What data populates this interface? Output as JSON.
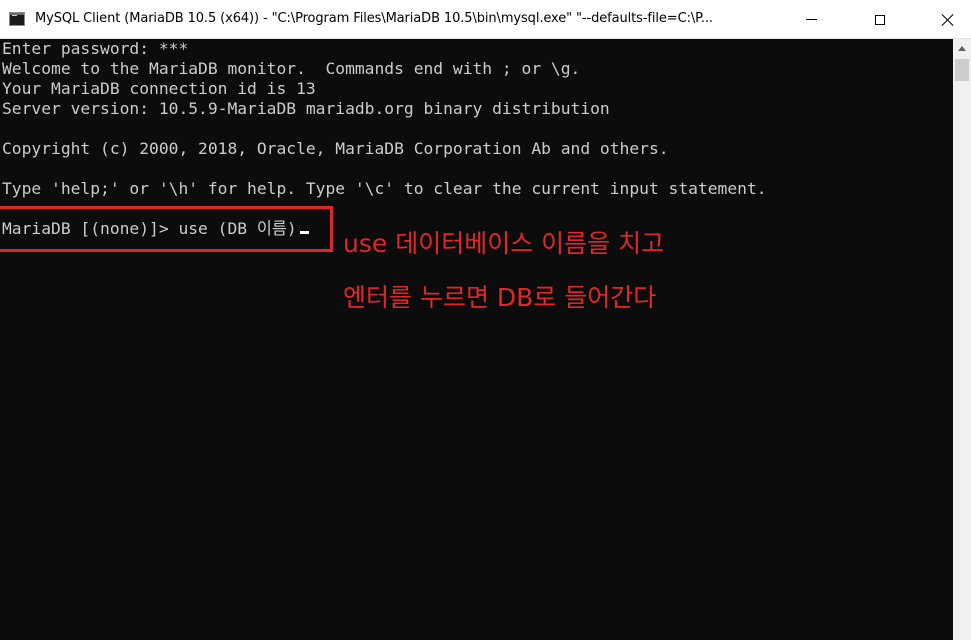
{
  "window": {
    "title": "MySQL Client (MariaDB 10.5 (x64)) - \"C:\\Program Files\\MariaDB 10.5\\bin\\mysql.exe\"  \"--defaults-file=C:\\P...",
    "icon": "cmd-console-icon",
    "controls": {
      "minimize": "minimize-icon",
      "maximize": "maximize-icon",
      "close": "close-icon"
    }
  },
  "console": {
    "lines": [
      "Enter password: ***",
      "Welcome to the MariaDB monitor.  Commands end with ; or \\g.",
      "Your MariaDB connection id is 13",
      "Server version: 10.5.9-MariaDB mariadb.org binary distribution",
      "",
      "Copyright (c) 2000, 2018, Oracle, MariaDB Corporation Ab and others.",
      "",
      "Type 'help;' or '\\h' for help. Type '\\c' to clear the current input statement.",
      ""
    ],
    "prompt": "MariaDB [(none)]> ",
    "input": "use (DB 이름)"
  },
  "annotation": {
    "line1": "use 데이터베이스 이름을 치고",
    "line2": "엔터를 누르면 DB로 들어간다",
    "color": "#e02828"
  },
  "colors": {
    "console_bg": "#0c0c0c",
    "console_text": "#cccccc",
    "titlebar_bg": "#ffffff"
  }
}
